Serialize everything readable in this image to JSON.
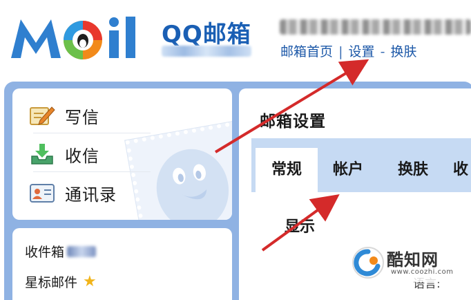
{
  "header": {
    "logo_text": "MOil",
    "brand": "QQ邮箱",
    "top_links": [
      "邮箱首页",
      "设置",
      "换肤"
    ],
    "link_separators": [
      "|",
      "-"
    ]
  },
  "sidebar": {
    "nav": [
      {
        "label": "写信",
        "icon": "write-icon"
      },
      {
        "label": "收信",
        "icon": "inbox-download-icon"
      },
      {
        "label": "通讯录",
        "icon": "contacts-card-icon"
      }
    ],
    "folders": [
      {
        "label": "收件箱"
      },
      {
        "label": "星标邮件",
        "icon": "star-icon"
      }
    ]
  },
  "settings": {
    "title": "邮箱设置",
    "tabs": [
      {
        "label": "常规",
        "active": true
      },
      {
        "label": "帐户",
        "active": false
      },
      {
        "label": "换肤",
        "active": false
      },
      {
        "label": "收",
        "active": false
      }
    ],
    "section": "显示",
    "lang_label": "语言:"
  },
  "watermark": {
    "title": "酷知网",
    "url": "www.coozhi.com"
  },
  "colors": {
    "accent": "#1c58a8",
    "frame": "#8fb2e3",
    "tabbar": "#c6daf3",
    "arrow": "#d42a2a",
    "star": "#f1b41a"
  }
}
